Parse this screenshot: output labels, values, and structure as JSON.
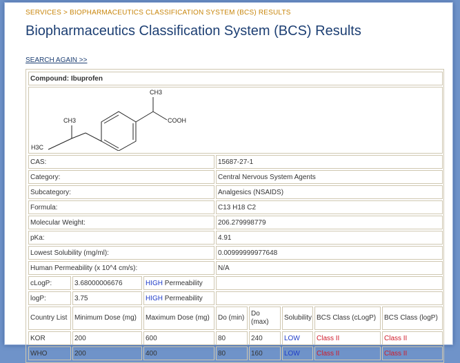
{
  "breadcrumb": "SERVICES > BIOPHARMACEUTICS CLASSIFICATION SYSTEM (BCS) RESULTS",
  "title": "Biopharmaceutics Classification System (BCS) Results",
  "search_again": "SEARCH AGAIN >>",
  "compound_label": "Compound: Ibuprofen",
  "structure": {
    "ch3_top": "CH3",
    "ch3_left": "CH3",
    "h3c": "H3C",
    "cooh": "COOH"
  },
  "properties": [
    {
      "label": "CAS:",
      "value": "15687-27-1"
    },
    {
      "label": "Category:",
      "value": "Central Nervous System Agents"
    },
    {
      "label": "Subcategory:",
      "value": "Analgesics (NSAIDS)"
    },
    {
      "label": "Formula:",
      "value": "C13 H18 C2"
    },
    {
      "label": "Molecular Weight:",
      "value": "206.279998779"
    },
    {
      "label": "pKa:",
      "value": "4.91"
    },
    {
      "label": "Lowest Solubility (mg/ml):",
      "value": "0.00999999977648"
    },
    {
      "label": "Human Permeability (x 10^4 cm/s):",
      "value": "N/A"
    }
  ],
  "permeability": [
    {
      "label": "cLogP:",
      "value": "3.68000006676",
      "level": "HIGH",
      "suffix": " Permeability"
    },
    {
      "label": "logP:",
      "value": "3.75",
      "level": "HIGH",
      "suffix": " Permeability"
    }
  ],
  "dose_table": {
    "headers": [
      "Country List",
      "Minimum Dose (mg)",
      "Maximum Dose (mg)",
      "Do (min)",
      "Do (max)",
      "Solubility",
      "BCS Class (cLogP)",
      "BCS Class (logP)"
    ],
    "rows": [
      [
        "KOR",
        "200",
        "600",
        "80",
        "240",
        "LOW",
        "Class II",
        "Class II"
      ],
      [
        "WHO",
        "200",
        "400",
        "80",
        "160",
        "LOW",
        "Class II",
        "Class II"
      ]
    ]
  },
  "colors": {
    "accent_blue": "#1f3cc8",
    "class_red": "#d01c2a",
    "breadcrumb_orange": "#c8860c",
    "title_blue": "#1d3f73"
  }
}
